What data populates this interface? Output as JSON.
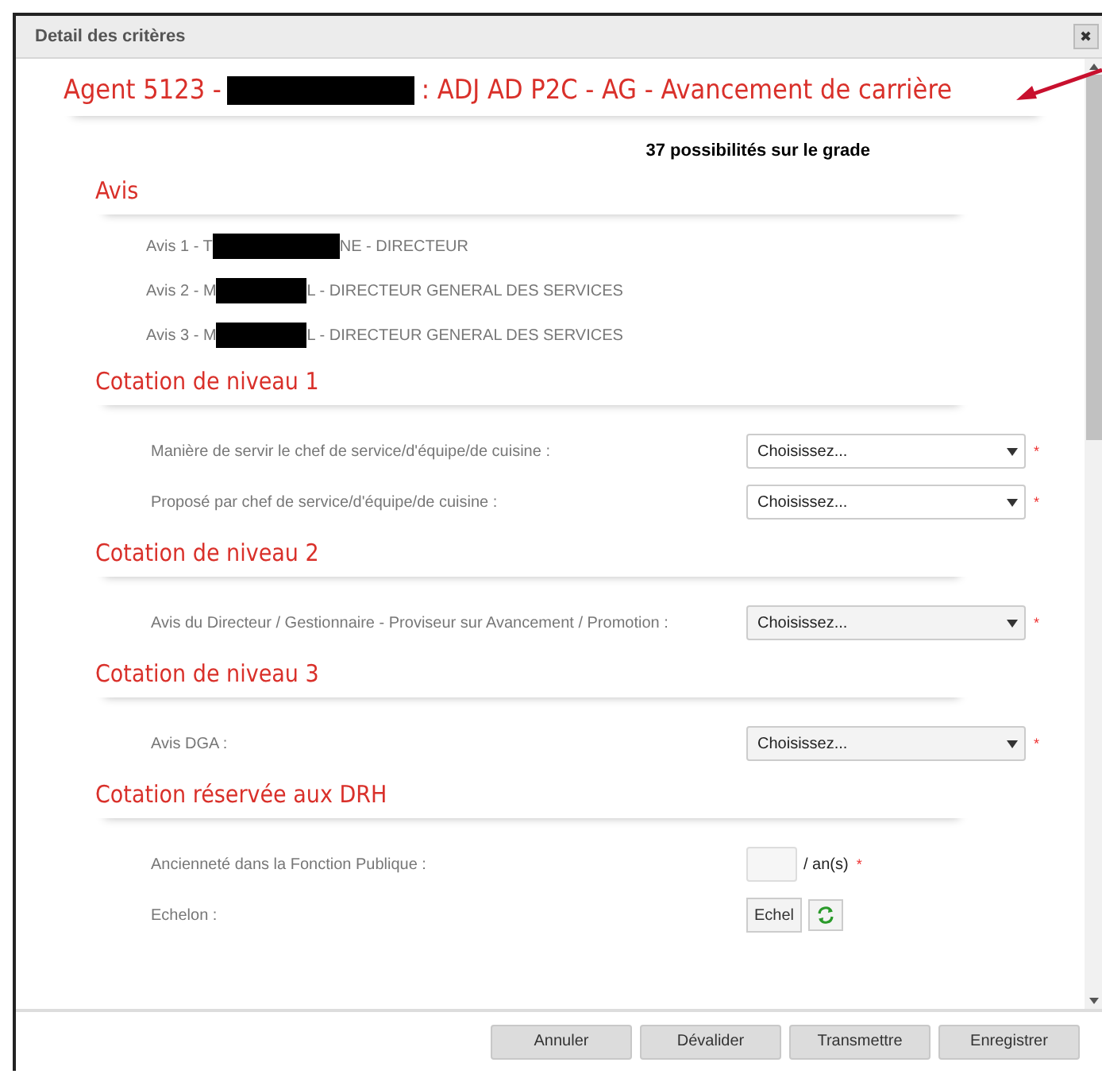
{
  "dialog": {
    "title": "Detail des critères",
    "close": "✖"
  },
  "heading": {
    "prefix": "Agent 5123 -",
    "suffix": ": ADJ AD P2C - AG - Avancement de carrière"
  },
  "possibilities": "37 possibilités sur le grade",
  "sections": [
    {
      "title": "Avis",
      "avis": [
        {
          "prefix": "Avis 1 - T",
          "suffix": "NE - DIRECTEUR"
        },
        {
          "prefix": "Avis 2 - M",
          "suffix": "L - DIRECTEUR GENERAL DES SERVICES"
        },
        {
          "prefix": "Avis 3 - M",
          "suffix": "L - DIRECTEUR GENERAL DES SERVICES"
        }
      ]
    },
    {
      "title": "Cotation de niveau 1",
      "fields": [
        {
          "kind": "select",
          "label": "Manière de servir le chef de service/d'équipe/de cuisine :",
          "value": "Choisissez...",
          "disabled": false,
          "required_mark": "*"
        },
        {
          "kind": "select",
          "label": "Proposé par chef de service/d'équipe/de cuisine :",
          "value": "Choisissez...",
          "disabled": false,
          "required_mark": "*"
        }
      ]
    },
    {
      "title": "Cotation de niveau 2",
      "fields": [
        {
          "kind": "select",
          "label": "Avis du Directeur / Gestionnaire - Proviseur sur Avancement / Promotion :",
          "value": "Choisissez...",
          "disabled": true,
          "required_mark": "*"
        }
      ]
    },
    {
      "title": "Cotation de niveau 3",
      "fields": [
        {
          "kind": "select",
          "label": "Avis DGA :",
          "value": "Choisissez...",
          "disabled": true,
          "required_mark": "*"
        }
      ]
    },
    {
      "title": "Cotation réservée aux DRH",
      "fields": [
        {
          "kind": "number",
          "label": "Ancienneté dans la Fonction Publique :",
          "unit": "/ an(s)",
          "required_mark": "*"
        },
        {
          "kind": "echelon",
          "label": "Echelon :",
          "button": "Echel"
        }
      ]
    }
  ],
  "buttons": [
    "Annuler",
    "Dévalider",
    "Transmettre",
    "Enregistrer"
  ]
}
